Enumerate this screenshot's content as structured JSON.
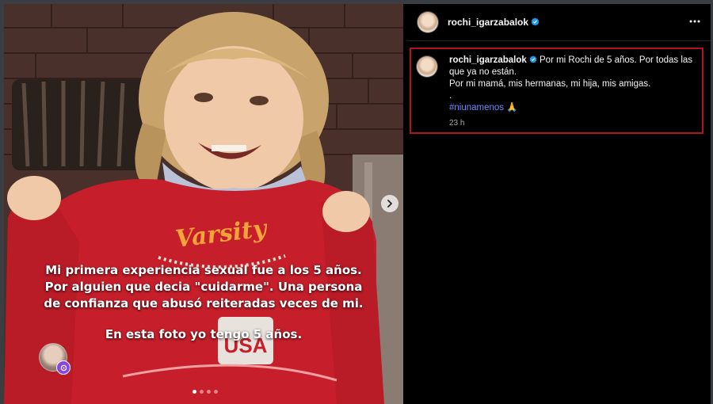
{
  "post": {
    "username": "rochi_igarzabalok",
    "icons": {
      "verified": "verified-badge-icon",
      "more": "more-options-icon",
      "next": "chevron-right-icon",
      "tag": "reel-tag-icon"
    }
  },
  "media": {
    "overlay_lines": [
      "Mi primera experiencia sexual fue a los 5 años.",
      "Por alguien que decia \"cuidarme\". Una persona",
      "de confianza que abusó reiteradas veces de mi.",
      "En esta foto yo tengo 5 años."
    ],
    "sweater_text": "Varsity",
    "shirt_text": "USA",
    "carousel_count": 4,
    "carousel_active": 1
  },
  "caption": {
    "username": "rochi_igarzabalok",
    "line1": "Por mi Rochi de 5 años. Por todas las que ya no están.",
    "line2": "Por mi mamá, mis hermanas, mi hija, mis amigas.",
    "line3": ".",
    "hashtag": "#niunamenos",
    "emoji": "🙏",
    "time": "23 h"
  },
  "colors": {
    "accent_link": "#6b8cff",
    "verified": "#1d9bf0",
    "highlight_border": "#b0141c"
  }
}
